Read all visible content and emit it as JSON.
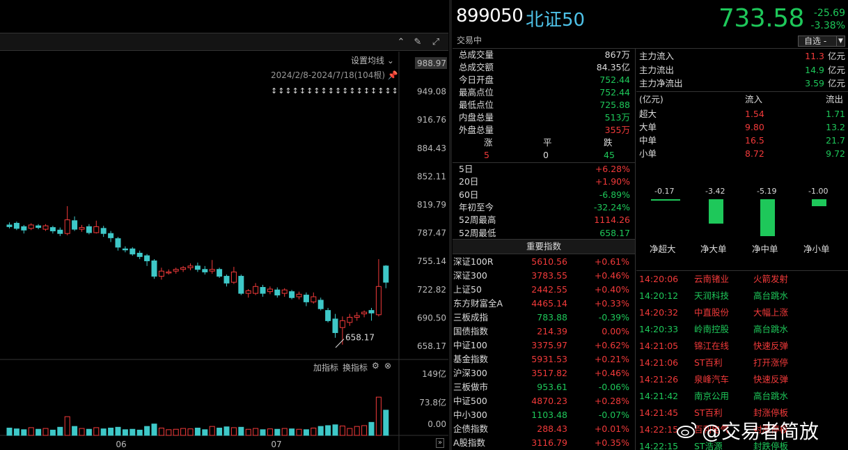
{
  "chart": {
    "setting_ma": "设置均线",
    "date_range": "2024/2/8-2024/7/18(104根)",
    "price_axis": [
      "988.97",
      "949.08",
      "916.76",
      "884.43",
      "852.11",
      "819.79",
      "787.47",
      "755.14",
      "722.82",
      "690.50",
      "658.17"
    ],
    "low_marker": "658.17",
    "volume_axis": [
      "149亿",
      "73.8亿",
      "0.00"
    ],
    "indicator_add": "加指标",
    "indicator_switch": "换指标",
    "x_ticks": [
      "06",
      "07"
    ],
    "arrows_count_label": "↕↕↕↕↕↕↕↕↕↕↕↕↕↕↕↕↕↕",
    "bull_color": "#f23a3a",
    "bear_color": "#3ec8c8"
  },
  "quote": {
    "code": "899050",
    "name": "北证50",
    "status": "交易中",
    "price": "733.58",
    "change": "-25.69",
    "change_pct": "-3.38%",
    "select_label": "自选 -"
  },
  "stats": [
    {
      "label": "总成交量",
      "value": "867万",
      "color": "white"
    },
    {
      "label": "总成交额",
      "value": "84.35亿",
      "color": "white"
    },
    {
      "label": "今日开盘",
      "value": "752.44",
      "color": "green"
    },
    {
      "label": "最高点位",
      "value": "752.44",
      "color": "green"
    },
    {
      "label": "最低点位",
      "value": "725.88",
      "color": "green"
    },
    {
      "label": "内盘总量",
      "value": "513万",
      "color": "green"
    },
    {
      "label": "外盘总量",
      "value": "355万",
      "color": "red"
    }
  ],
  "breadth": {
    "headers": [
      "涨",
      "平",
      "跌"
    ],
    "values": [
      "5",
      "0",
      "45"
    ]
  },
  "periods": [
    {
      "label": "5日",
      "value": "+6.28%",
      "color": "red"
    },
    {
      "label": "20日",
      "value": "+1.90%",
      "color": "red"
    },
    {
      "label": "60日",
      "value": "-6.89%",
      "color": "green"
    },
    {
      "label": "年初至今",
      "value": "-32.24%",
      "color": "green"
    },
    {
      "label": "52周最高",
      "value": "1114.26",
      "color": "red"
    },
    {
      "label": "52周最低",
      "value": "658.17",
      "color": "green"
    }
  ],
  "flow": {
    "main": [
      {
        "label": "主力流入",
        "value": "11.3",
        "unit": "亿元",
        "color": "red"
      },
      {
        "label": "主力流出",
        "value": "14.9",
        "unit": "亿元",
        "color": "green"
      },
      {
        "label": "主力净流出",
        "value": "3.59",
        "unit": "亿元",
        "color": "green"
      }
    ],
    "table_header": [
      "(亿元)",
      "流入",
      "流出"
    ],
    "table": [
      {
        "label": "超大",
        "in": "1.54",
        "out": "1.71"
      },
      {
        "label": "大单",
        "in": "9.80",
        "out": "13.2"
      },
      {
        "label": "中单",
        "in": "16.5",
        "out": "21.7"
      },
      {
        "label": "小单",
        "in": "8.72",
        "out": "9.72"
      }
    ],
    "net": [
      {
        "label": "净超大",
        "value": "-0.17",
        "num": -0.17
      },
      {
        "label": "净大单",
        "value": "-3.42",
        "num": -3.42
      },
      {
        "label": "净中单",
        "value": "-5.19",
        "num": -5.19
      },
      {
        "label": "净小单",
        "value": "-1.00",
        "num": -1.0
      }
    ]
  },
  "index_title": "重要指数",
  "indices": [
    {
      "name": "深证100R",
      "price": "5610.56",
      "pct": "+0.61%",
      "color": "red"
    },
    {
      "name": "深证300",
      "price": "3783.55",
      "pct": "+0.46%",
      "color": "red"
    },
    {
      "name": "上证50",
      "price": "2442.55",
      "pct": "+0.40%",
      "color": "red"
    },
    {
      "name": "东方财富全A",
      "price": "4465.14",
      "pct": "+0.33%",
      "color": "red"
    },
    {
      "name": "三板成指",
      "price": "783.88",
      "pct": "-0.39%",
      "color": "green"
    },
    {
      "name": "国债指数",
      "price": "214.39",
      "pct": "0.00%",
      "color": "red"
    },
    {
      "name": "中证100",
      "price": "3375.97",
      "pct": "+0.62%",
      "color": "red"
    },
    {
      "name": "基金指数",
      "price": "5931.53",
      "pct": "+0.21%",
      "color": "red"
    },
    {
      "name": "沪深300",
      "price": "3517.82",
      "pct": "+0.46%",
      "color": "red"
    },
    {
      "name": "三板做市",
      "price": "953.61",
      "pct": "-0.06%",
      "color": "green"
    },
    {
      "name": "中证500",
      "price": "4870.23",
      "pct": "+0.28%",
      "color": "red"
    },
    {
      "name": "中小300",
      "price": "1103.48",
      "pct": "-0.07%",
      "color": "green"
    },
    {
      "name": "企债指数",
      "price": "288.43",
      "pct": "+0.01%",
      "color": "red"
    },
    {
      "name": "A股指数",
      "price": "3116.79",
      "pct": "+0.35%",
      "color": "red"
    }
  ],
  "feed": [
    {
      "time": "14:20:06",
      "stock": "云南锗业",
      "event": "火箭发射",
      "color": "red"
    },
    {
      "time": "14:20:12",
      "stock": "天润科技",
      "event": "高台跳水",
      "color": "green"
    },
    {
      "time": "14:20:32",
      "stock": "中直股份",
      "event": "大幅上涨",
      "color": "red"
    },
    {
      "time": "14:20:33",
      "stock": "岭南控股",
      "event": "高台跳水",
      "color": "green"
    },
    {
      "time": "14:21:05",
      "stock": "锦江在线",
      "event": "快速反弹",
      "color": "red"
    },
    {
      "time": "14:21:06",
      "stock": "ST百利",
      "event": "打开涨停",
      "color": "red"
    },
    {
      "time": "14:21:26",
      "stock": "泉峰汽车",
      "event": "快速反弹",
      "color": "red"
    },
    {
      "time": "14:21:42",
      "stock": "南京公用",
      "event": "高台跳水",
      "color": "green"
    },
    {
      "time": "14:21:45",
      "stock": "ST百利",
      "event": "封涨停板",
      "color": "red"
    },
    {
      "time": "14:22:15",
      "stock": "百利电气",
      "event": "封涨停板",
      "color": "red"
    },
    {
      "time": "14:22:15",
      "stock": "ST浩源",
      "event": "封跌停板",
      "color": "green"
    }
  ],
  "watermark": "@交易者简放"
}
